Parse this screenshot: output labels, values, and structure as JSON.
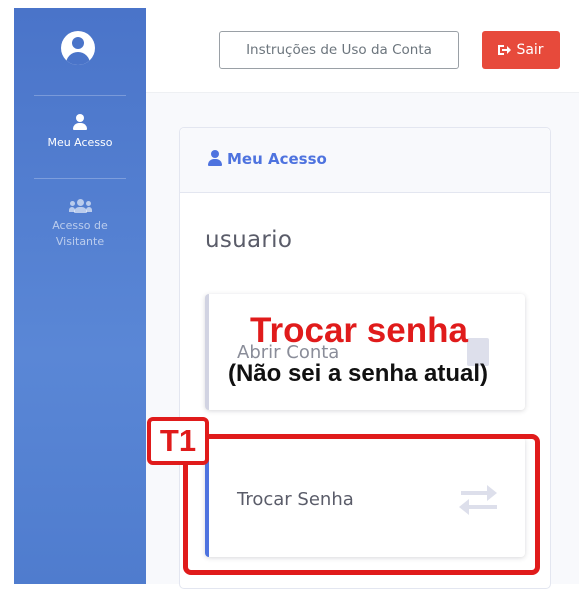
{
  "sidebar": {
    "items": [
      {
        "label": "Meu Acesso",
        "icon": "user-icon",
        "active": true
      },
      {
        "label": "Acesso de Visitante",
        "icon": "users-icon",
        "active": false
      }
    ]
  },
  "topbar": {
    "instructions_label": "Instruções de Uso da Conta",
    "logout_label": "Sair"
  },
  "card": {
    "title": "Meu Acesso",
    "username": "usuario",
    "options": [
      {
        "label": "Abrir Conta",
        "icon": "document-icon"
      },
      {
        "label": "Trocar Senha",
        "icon": "exchange-icon"
      }
    ]
  },
  "annotation": {
    "title": "Trocar senha",
    "subtitle": "(Não sei a senha atual)",
    "tag": "T1",
    "color": "#e01b1b"
  },
  "colors": {
    "sidebar": "#4a74c9",
    "primary": "#4e73df",
    "danger": "#e74a3b"
  }
}
